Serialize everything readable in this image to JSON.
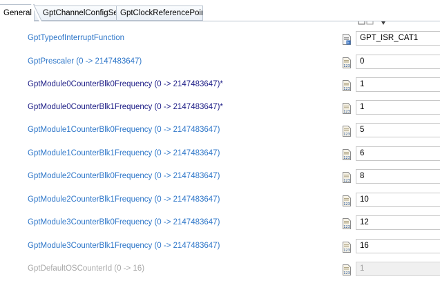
{
  "tabs": [
    {
      "label": "General",
      "active": true
    },
    {
      "label": "GptChannelConfigSet",
      "active": false
    },
    {
      "label": "GptClockReferencePoint",
      "active": false
    }
  ],
  "params": [
    {
      "label": "GptTypeofInterruptFunction",
      "value": "GPT_ISR_CAT1",
      "style": "link",
      "icon": "enum-parameter-icon"
    },
    {
      "label": "GptPrescaler (0 -> 2147483647)",
      "value": "0",
      "style": "link",
      "icon": "integer-parameter-icon"
    },
    {
      "label": "GptModule0CounterBlk0Frequency (0 -> 2147483647)*",
      "value": "1",
      "style": "modified",
      "icon": "integer-parameter-icon"
    },
    {
      "label": "GptModule0CounterBlk1Frequency (0 -> 2147483647)*",
      "value": "1",
      "style": "modified",
      "icon": "integer-parameter-icon"
    },
    {
      "label": "GptModule1CounterBlk0Frequency (0 -> 2147483647)",
      "value": "5",
      "style": "link",
      "icon": "integer-parameter-icon"
    },
    {
      "label": "GptModule1CounterBlk1Frequency (0 -> 2147483647)",
      "value": "6",
      "style": "link",
      "icon": "integer-parameter-icon"
    },
    {
      "label": "GptModule2CounterBlk0Frequency (0 -> 2147483647)",
      "value": "8",
      "style": "link",
      "icon": "integer-parameter-icon"
    },
    {
      "label": "GptModule2CounterBlk1Frequency (0 -> 2147483647)",
      "value": "10",
      "style": "link",
      "icon": "integer-parameter-icon"
    },
    {
      "label": "GptModule3CounterBlk0Frequency (0 -> 2147483647)",
      "value": "12",
      "style": "link",
      "icon": "integer-parameter-icon"
    },
    {
      "label": "GptModule3CounterBlk1Frequency (0 -> 2147483647)",
      "value": "16",
      "style": "link",
      "icon": "integer-parameter-icon"
    },
    {
      "label": "GptDefaultOSCounterId (0 -> 16)",
      "value": "1",
      "style": "disabled",
      "icon": "integer-parameter-icon"
    }
  ],
  "colors": {
    "link": "#2f77c9",
    "modified": "#1c1c86",
    "disabled": "#a8a8a8",
    "tab_border": "#b9c3cf"
  }
}
